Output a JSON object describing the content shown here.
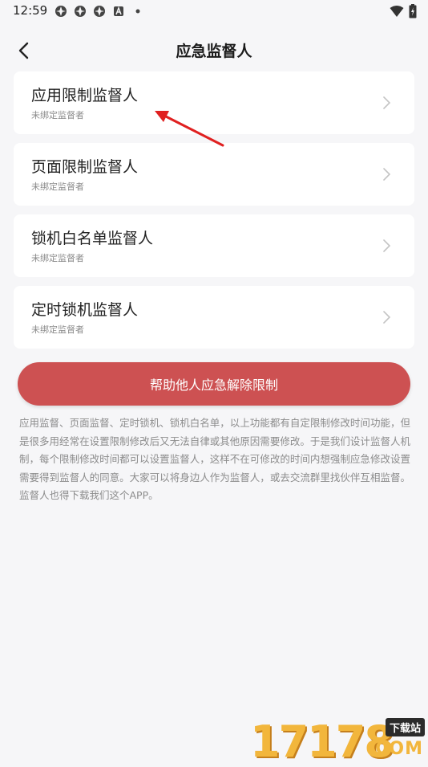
{
  "status_bar": {
    "time": "12:59",
    "notification_icons": [
      "app-icon",
      "app-icon",
      "app-icon",
      "a-icon",
      "dot-icon"
    ],
    "right_icons": [
      "wifi-icon",
      "battery-icon"
    ]
  },
  "header": {
    "title": "应急监督人",
    "back_icon": "chevron-left-icon"
  },
  "cards": [
    {
      "title": "应用限制监督人",
      "subtitle": "未绑定监督者"
    },
    {
      "title": "页面限制监督人",
      "subtitle": "未绑定监督者"
    },
    {
      "title": "锁机白名单监督人",
      "subtitle": "未绑定监督者"
    },
    {
      "title": "定时锁机监督人",
      "subtitle": "未绑定监督者"
    }
  ],
  "help_button": {
    "label": "帮助他人应急解除限制"
  },
  "description": "应用监督、页面监督、定时锁机、锁机白名单，以上功能都有自定限制修改时间功能，但是很多用经常在设置限制修改后又无法自律或其他原因需要修改。于是我们设计监督人机制，每个限制修改时间都可以设置监督人，这样不在可修改的时间内想强制应急修改设置需要得到监督人的同意。大家可以将身边人作为监督人，或去交流群里找伙伴互相监督。监督人也得下载我们这个APP。",
  "watermark": {
    "digits": "17178",
    "badge": "下载站",
    "domain": "COM"
  },
  "colors": {
    "accent": "#cd5152",
    "annotation_arrow": "#e02020",
    "background": "#f6f6f8",
    "card": "#ffffff",
    "muted_text": "#8a8a8a"
  }
}
